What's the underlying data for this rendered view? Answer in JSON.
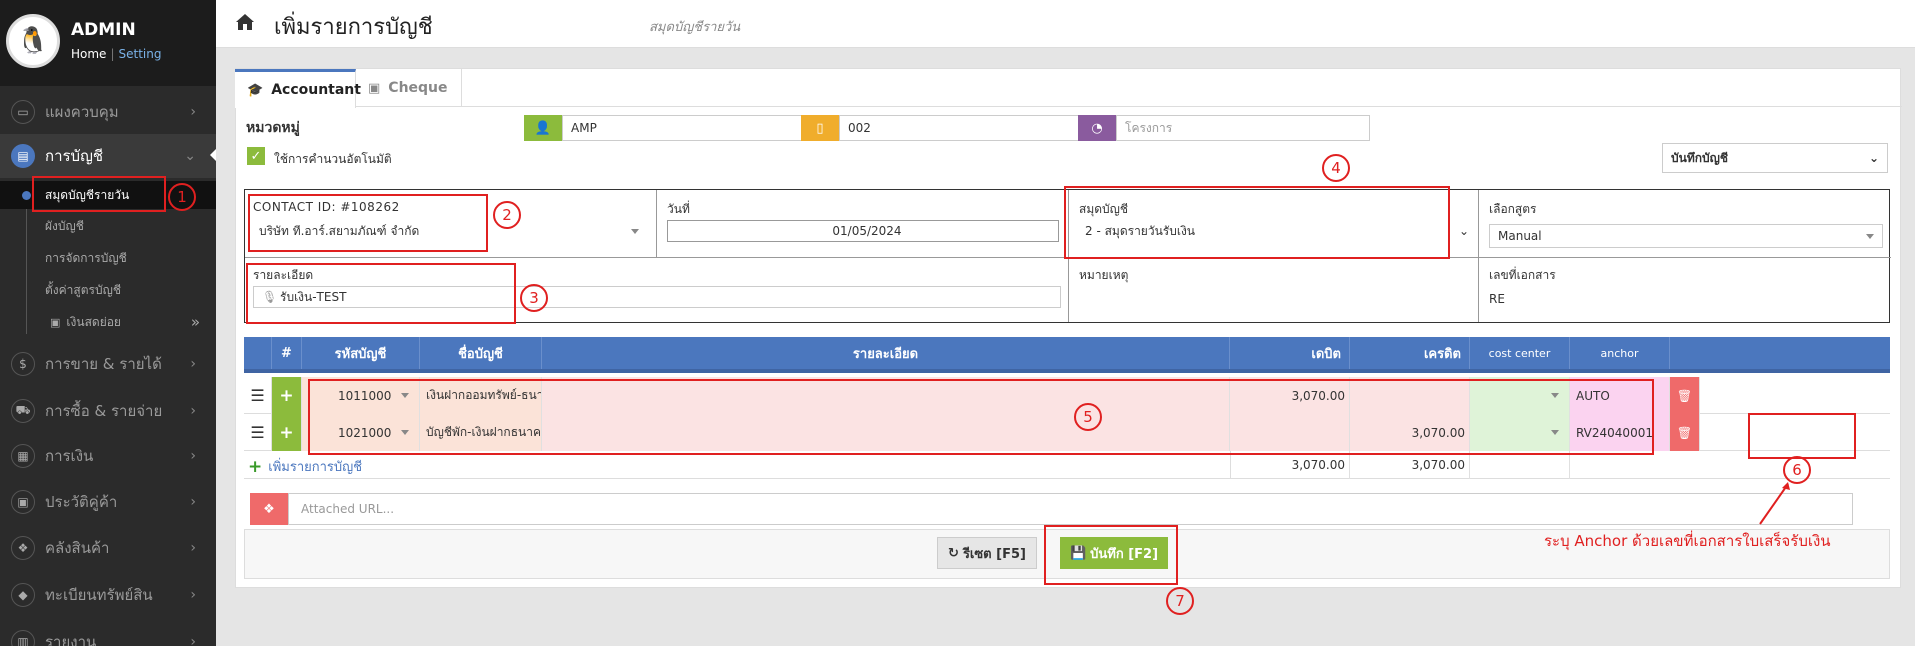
{
  "sidebar": {
    "user": "ADMIN",
    "home": "Home",
    "setting": "Setting",
    "menu": [
      {
        "label": "แผงควบคุม",
        "icon": "monitor-icon"
      },
      {
        "label": "การบัญชี",
        "icon": "book-icon"
      },
      {
        "label": "การขาย & รายได้",
        "icon": "dollar-icon"
      },
      {
        "label": "การซื้อ & รายจ่าย",
        "icon": "cart-icon"
      },
      {
        "label": "การเงิน",
        "icon": "calendar-icon"
      },
      {
        "label": "ประวัติคู่ค้า",
        "icon": "id-card-icon"
      },
      {
        "label": "คลังสินค้า",
        "icon": "cubes-icon"
      },
      {
        "label": "ทะเบียนทรัพย์สิน",
        "icon": "diamond-icon"
      },
      {
        "label": "รายงาน",
        "icon": "report-icon"
      }
    ],
    "submenu": [
      "สมุดบัญชีรายวัน",
      "ผังบัญชี",
      "การจัดการบัญชี",
      "ตั้งค่าสูตรบัญชี",
      "เงินสดย่อย"
    ]
  },
  "header": {
    "title": "เพิ่มรายการบัญชี",
    "subtitle": "สมุดบัญชีรายวัน"
  },
  "tabs": [
    "Accountant",
    "Cheque"
  ],
  "form": {
    "group_label": "หมวดหมู่",
    "auto_calc_label": "ใช้การคำนวนอัตโนมัติ",
    "branch_value": "AMP",
    "doc_code_value": "002",
    "project_placeholder": "โครงการ",
    "save_mode": "บันทึกบัญชี",
    "contact_label": "CONTACT ID: #108262",
    "contact_value": "บริษัท ที.อาร์.สยามภัณฑ์ จำกัด",
    "date_label": "วันที่",
    "date_value": "01/05/2024",
    "journal_label": "สมุดบัญชี",
    "journal_value": "2 - สมุดรายวันรับเงิน",
    "formula_label": "เลือกสูตร",
    "formula_value": "Manual",
    "detail_label": "รายละเอียด",
    "detail_value": "รับเงิน-TEST",
    "remark_label": "หมายเหตุ",
    "docno_label": "เลขที่เอกสาร",
    "docno_value": "RE"
  },
  "table": {
    "headers": [
      "#",
      "รหัสบัญชี",
      "ชื่อบัญชี",
      "รายละเอียด",
      "เดบิต",
      "เครดิต",
      "cost center",
      "anchor"
    ],
    "rows": [
      {
        "code": "1011000",
        "name": "เงินฝากออมทรัพย์-ธนาคาร",
        "detail": "",
        "debit": "3,070.00",
        "credit": "",
        "anchor": "AUTO"
      },
      {
        "code": "1021000",
        "name": "บัญชีพัก-เงินฝากธนาคาร",
        "detail": "",
        "debit": "",
        "credit": "3,070.00",
        "anchor": "RV24040001"
      }
    ],
    "add_label": "เพิ่มรายการบัญชี",
    "total_debit": "3,070.00",
    "total_credit": "3,070.00",
    "attach_placeholder": "Attached URL..."
  },
  "buttons": {
    "reset": "รีเซต [F5]",
    "save": "บันทึก [F2]"
  },
  "annotations": {
    "numbers": [
      "1",
      "2",
      "3",
      "4",
      "5",
      "6",
      "7"
    ],
    "note": "ระบุ Anchor ด้วยเลขที่เอกสารใบเสร็จรับเงิน"
  },
  "colors": {
    "accent": "#4b77be",
    "green": "#8cbb3c",
    "annotation": "#e02020",
    "yellow": "#f0ad2c",
    "purple": "#8a5b9e"
  }
}
